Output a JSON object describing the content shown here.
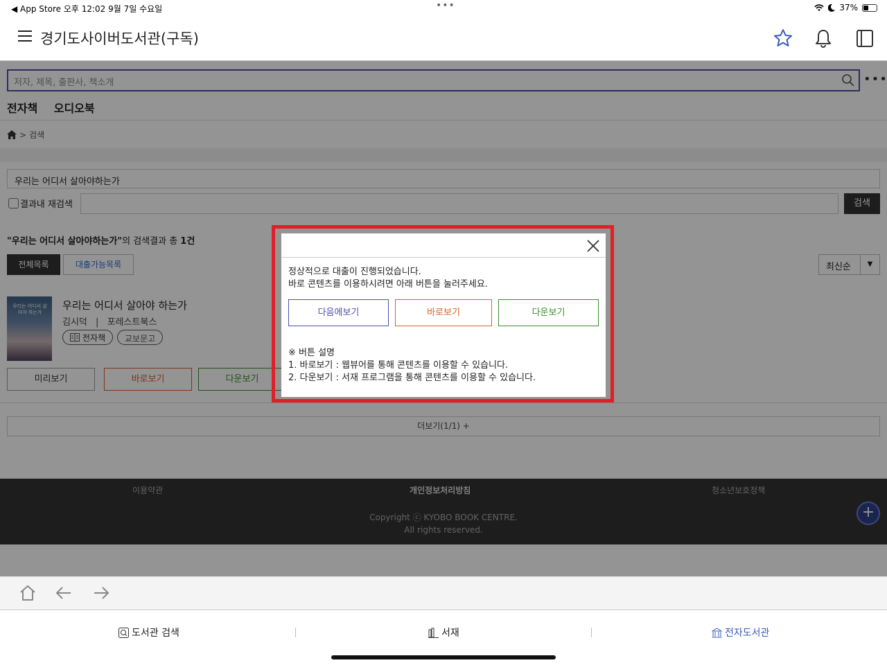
{
  "status": {
    "left": "◀ App Store  오후 12:02   9월 7일 수요일",
    "dots": "•••",
    "battery": "37%"
  },
  "header": {
    "title": "경기도사이버도서관(구독)",
    "icons": [
      "menu-icon",
      "star-icon",
      "bell-icon",
      "book-icon"
    ]
  },
  "search": {
    "placeholder": "저자, 제목, 출판사, 책소개",
    "more": "•••"
  },
  "tabs": [
    "전자책",
    "오디오북"
  ],
  "breadcrumb": {
    "sep": ">",
    "current": "검색"
  },
  "query": {
    "value": "우리는 어디서 살아야하는가",
    "recheck_label": "결과내 재검색",
    "search_button": "검색"
  },
  "result": {
    "quoted": "\"우리는 어디서 살아야하는가\"",
    "suffix": "의 검색결과 총 ",
    "count": "1건",
    "filter_all": "전체목록",
    "filter_avail": "대출가능목록",
    "sort": "최신순"
  },
  "book": {
    "cover_text": "우리는 어디서 살아야 하는가",
    "title": "우리는 어디서 살아야 하는가",
    "author": "김시덕",
    "divider": "|",
    "publisher": "포레스트북스",
    "badge_type": "전자책",
    "badge_source": "교보문고",
    "btn_preview": "미리보기",
    "btn_view": "바로보기",
    "btn_download": "다운보기"
  },
  "more": "더보기(1/1) +",
  "footer": {
    "terms": "이용약관",
    "privacy": "개인정보처리방침",
    "youth": "청소년보호정책",
    "copy1": "Copyright ⓒ KYOBO BOOK CENTRE.",
    "copy2": "All rights reserved."
  },
  "modal": {
    "line1": "정상적으로 대출이 진행되었습니다.",
    "line2": "바로 콘텐츠를 이용하시려면 아래 버튼을 눌러주세요.",
    "btn_later": "다음에보기",
    "btn_view": "바로보기",
    "btn_download": "다운보기",
    "help_title": "※ 버튼 설명",
    "help1": "1. 바로보기 : 웹뷰어를 통해 콘텐츠를 이용할 수 있습니다.",
    "help2": "2. 다운보기 : 서재 프로그램을 통해 콘텐츠를 이용할 수 있습니다."
  },
  "bottom_tabs": {
    "search": "도서관 검색",
    "shelf": "서재",
    "library": "전자도서관"
  },
  "colors": {
    "later": "#4a4fa8",
    "view": "#d2622a",
    "download": "#3a8a2e",
    "highlight": "#e01f26",
    "accent": "#3a5bbf"
  }
}
